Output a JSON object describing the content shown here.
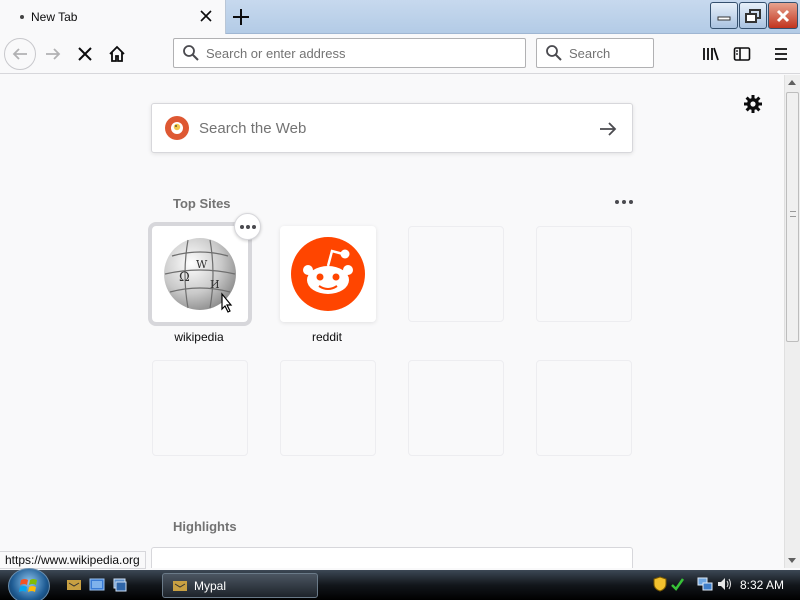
{
  "tab": {
    "title": "New Tab"
  },
  "navbar": {
    "url_placeholder": "Search or enter address",
    "search_placeholder": "Search"
  },
  "newtab": {
    "web_search_placeholder": "Search the Web",
    "top_sites_title": "Top Sites",
    "highlights_title": "Highlights",
    "tiles": [
      {
        "label": "wikipedia",
        "icon": "wikipedia-globe-icon"
      },
      {
        "label": "reddit",
        "icon": "reddit-alien-icon"
      },
      {
        "label": ""
      },
      {
        "label": ""
      },
      {
        "label": ""
      },
      {
        "label": ""
      },
      {
        "label": ""
      },
      {
        "label": ""
      }
    ]
  },
  "status_url": "https://www.wikipedia.org",
  "taskbar": {
    "task_label": "Mypal",
    "clock": "8:32 AM"
  },
  "colors": {
    "reddit": "#ff4500",
    "duckduckgo": "#de5833",
    "close_button": "#c2341e"
  }
}
